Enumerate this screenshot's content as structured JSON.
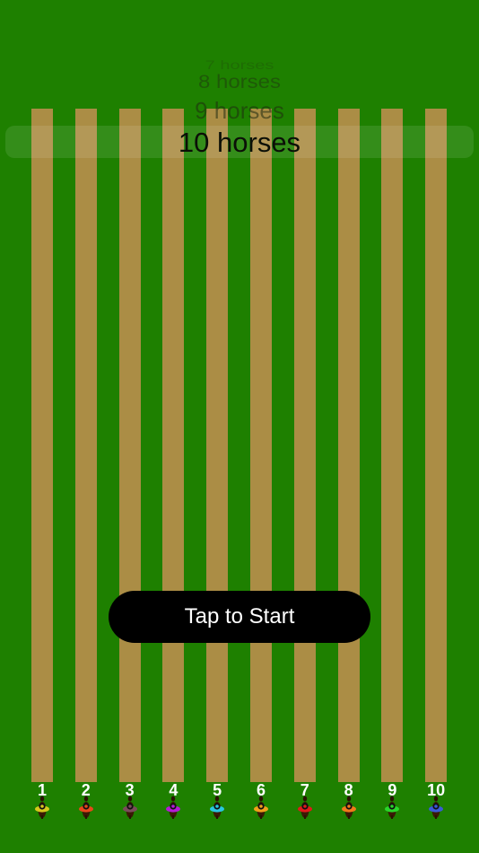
{
  "colors": {
    "grass": "#1e8000",
    "track": "#ab8d45",
    "button_bg": "#000000",
    "button_text": "#ffffff",
    "lane_number": "#ffffff"
  },
  "picker": {
    "options": [
      "7 horses",
      "8 horses",
      "9 horses",
      "10 horses"
    ],
    "selected": "10 horses"
  },
  "start_button": {
    "label": "Tap to Start"
  },
  "lanes": [
    {
      "number": "1",
      "silk_color": "#d6c81c"
    },
    {
      "number": "2",
      "silk_color": "#e8471a"
    },
    {
      "number": "3",
      "silk_color": "#7a4c5a"
    },
    {
      "number": "4",
      "silk_color": "#b51bd6"
    },
    {
      "number": "5",
      "silk_color": "#29c7e0"
    },
    {
      "number": "6",
      "silk_color": "#f0a21a"
    },
    {
      "number": "7",
      "silk_color": "#e01a1a"
    },
    {
      "number": "8",
      "silk_color": "#f07a1a"
    },
    {
      "number": "9",
      "silk_color": "#2ad62a"
    },
    {
      "number": "10",
      "silk_color": "#3a5ad6"
    }
  ]
}
